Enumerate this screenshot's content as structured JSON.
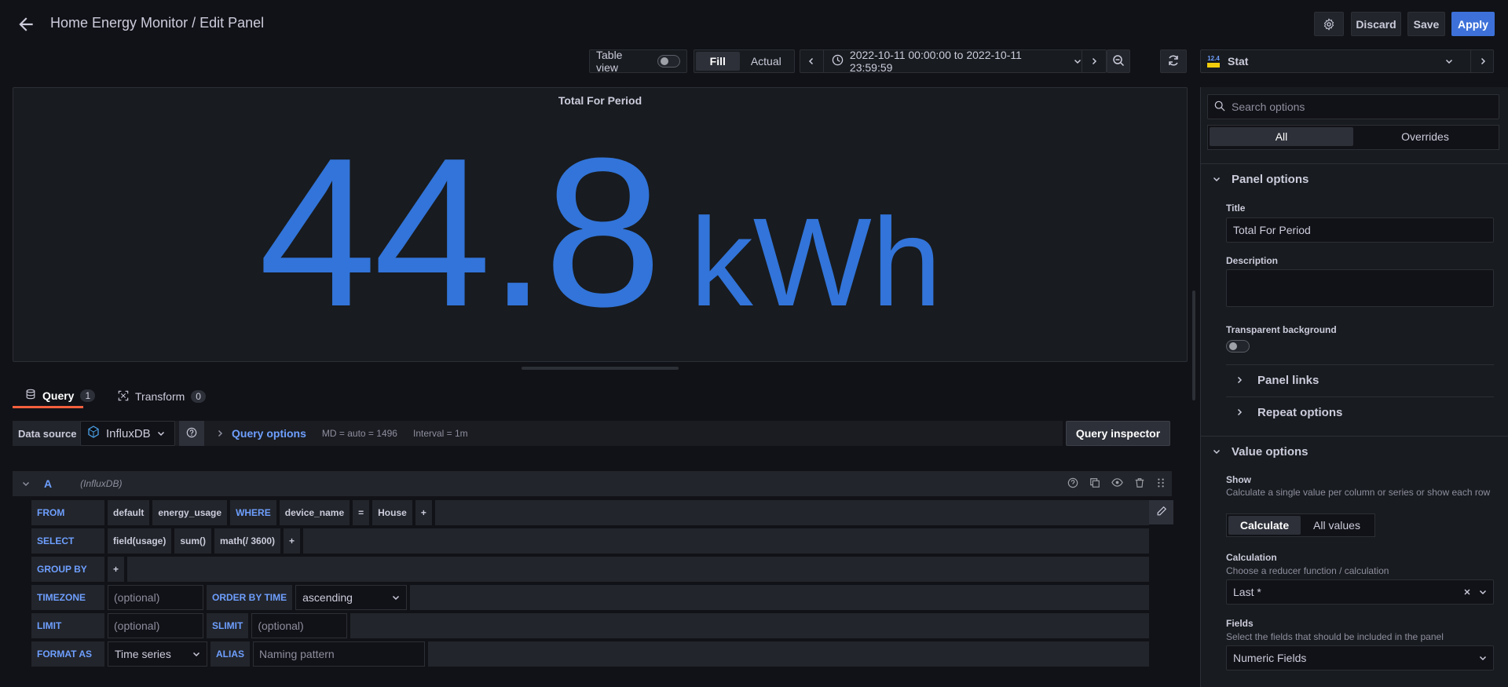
{
  "header": {
    "title": "Home Energy Monitor / Edit Panel",
    "discard_label": "Discard",
    "save_label": "Save",
    "apply_label": "Apply"
  },
  "toolbar": {
    "table_view_label": "Table view",
    "table_view_on": false,
    "fill_label": "Fill",
    "actual_label": "Actual",
    "active_mode": "Fill",
    "time_range": "2022-10-11 00:00:00 to 2022-10-11 23:59:59"
  },
  "viz_picker": {
    "selected": "Stat",
    "icon_badge": "12.4"
  },
  "panel": {
    "title": "Total For Period",
    "value": "44.8",
    "unit": "kWh",
    "value_color": "#3274d9"
  },
  "tabs": [
    {
      "label": "Query",
      "count": "1",
      "active": true
    },
    {
      "label": "Transform",
      "count": "0",
      "active": false
    }
  ],
  "datasource": {
    "label": "Data source",
    "selected": "InfluxDB",
    "query_options_label": "Query options",
    "md": "MD = auto = 1496",
    "interval": "Interval = 1m",
    "inspector_label": "Query inspector"
  },
  "query_a": {
    "ref": "A",
    "source": "(InfluxDB)",
    "from": {
      "kw": "FROM",
      "policy": "default",
      "measurement": "energy_usage",
      "where_kw": "WHERE",
      "tag": "device_name",
      "op": "=",
      "value": "House",
      "plus": "+"
    },
    "select": {
      "kw": "SELECT",
      "field": "field(usage)",
      "agg": "sum()",
      "math": "math(/ 3600)",
      "plus": "+"
    },
    "group_by": {
      "kw": "GROUP BY",
      "plus": "+"
    },
    "timezone": {
      "kw": "TIMEZONE",
      "placeholder": "(optional)",
      "order_kw": "ORDER BY TIME",
      "order_value": "ascending"
    },
    "limit": {
      "kw": "LIMIT",
      "placeholder": "(optional)",
      "slimit_kw": "SLIMIT",
      "slimit_placeholder": "(optional)"
    },
    "format": {
      "kw": "FORMAT AS",
      "value": "Time series",
      "alias_kw": "ALIAS",
      "alias_placeholder": "Naming pattern"
    }
  },
  "options": {
    "search_placeholder": "Search options",
    "all_label": "All",
    "overrides_label": "Overrides",
    "panel_options": {
      "heading": "Panel options",
      "title_label": "Title",
      "title_value": "Total For Period",
      "description_label": "Description",
      "transparent_label": "Transparent background",
      "transparent_on": false,
      "panel_links_label": "Panel links",
      "repeat_options_label": "Repeat options"
    },
    "value_options": {
      "heading": "Value options",
      "show_label": "Show",
      "show_desc": "Calculate a single value per column or series or show each row",
      "calculate_label": "Calculate",
      "all_values_label": "All values",
      "calculation_label": "Calculation",
      "calculation_desc": "Choose a reducer function / calculation",
      "calculation_value": "Last *",
      "fields_label": "Fields",
      "fields_desc": "Select the fields that should be included in the panel",
      "fields_value": "Numeric Fields"
    }
  },
  "colors": {
    "accent_blue": "#3d71d9",
    "tab_underline": "#f55f3e",
    "keyword_blue": "#6e9fff",
    "background": "#111217"
  }
}
